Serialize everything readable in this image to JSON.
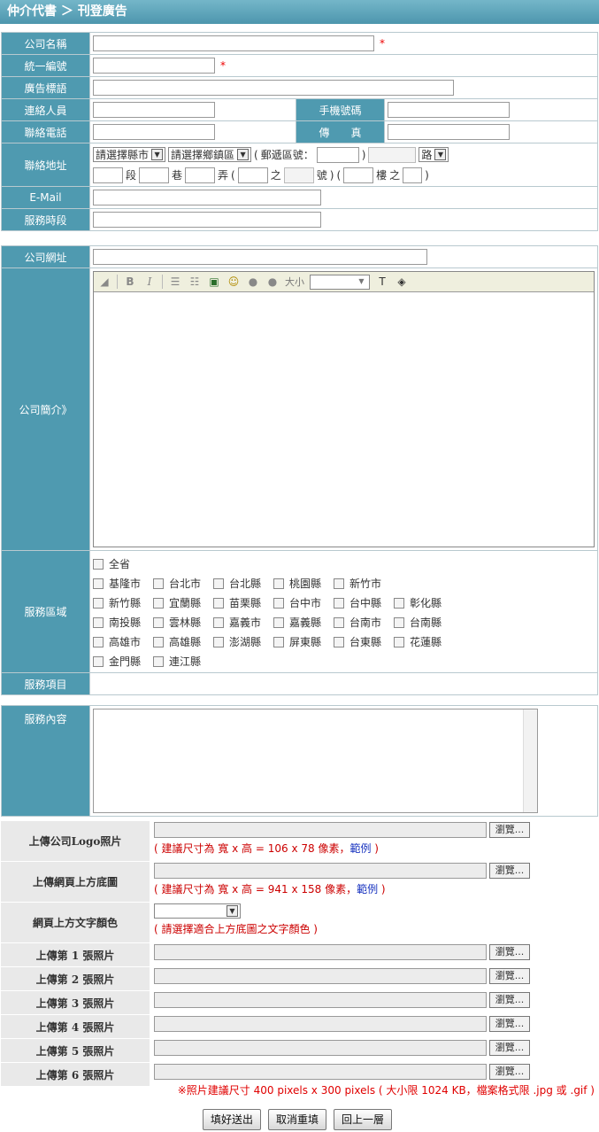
{
  "header": {
    "title": "仲介代書 ＞ 刊登廣告"
  },
  "section1": {
    "company_name": "公司名稱",
    "tax_id": "統一編號",
    "ad_title": "廣告標語",
    "contact_person": "連絡人員",
    "mobile": "手機號碼",
    "phone": "聯絡電話",
    "fax": "傳　　真",
    "address": "聯絡地址",
    "email": "E-Mail",
    "service_hours": "服務時段",
    "required_mark": "*"
  },
  "address": {
    "city_select": "請選擇縣市",
    "town_select": "請選擇鄉鎮區",
    "zip_open": "(",
    "zip_label": "郵遞區號：",
    "zip_close": ")",
    "road_select": "路",
    "section": "段",
    "lane": "巷",
    "alley": "弄",
    "paren_open": "(",
    "of": "之",
    "number": "號",
    "paren_close": ")",
    "paren_open2": "(",
    "floor": "樓",
    "of2": "之",
    "paren_close2": ")"
  },
  "section2": {
    "website": "公司網址",
    "intro": "公司簡介",
    "intro_suffix": "》",
    "regions_label": "服務區域",
    "service_items": "服務項目"
  },
  "editor": {
    "size_label": "大小"
  },
  "regions": [
    [
      "全省"
    ],
    [
      "基隆市",
      "台北市",
      "台北縣",
      "桃園縣",
      "新竹市"
    ],
    [
      "新竹縣",
      "宜蘭縣",
      "苗栗縣",
      "台中市",
      "台中縣",
      "彰化縣"
    ],
    [
      "南投縣",
      "雲林縣",
      "嘉義市",
      "嘉義縣",
      "台南市",
      "台南縣"
    ],
    [
      "高雄市",
      "高雄縣",
      "澎湖縣",
      "屏東縣",
      "台東縣",
      "花蓮縣"
    ],
    [
      "金門縣",
      "連江縣"
    ]
  ],
  "section3": {
    "service_content": "服務內容"
  },
  "upload": {
    "logo": "上傳公司Logo照片",
    "logo_hint": "( 建議尺寸為 寬 x 高 = 106 x 78 像素，",
    "banner": "上傳網頁上方底圖",
    "banner_hint": "( 建議尺寸為 寬 x 高 = 941 x 158 像素，",
    "example": "範例",
    "hint_close": " )",
    "text_color": "網頁上方文字顏色",
    "text_color_hint": "( 請選擇適合上方底圖之文字顏色 )",
    "photo1": "上傳第 1 張照片",
    "photo2": "上傳第 2 張照片",
    "photo3": "上傳第 3 張照片",
    "photo4": "上傳第 4 張照片",
    "photo5": "上傳第 5 張照片",
    "photo6": "上傳第 6 張照片",
    "browse": "瀏覽..."
  },
  "note": "※照片建議尺寸 400 pixels x 300 pixels ( 大小限 1024 KB，檔案格式限 .jpg 或 .gif )",
  "buttons": {
    "submit": "填好送出",
    "reset": "取消重填",
    "back": "回上一層"
  }
}
